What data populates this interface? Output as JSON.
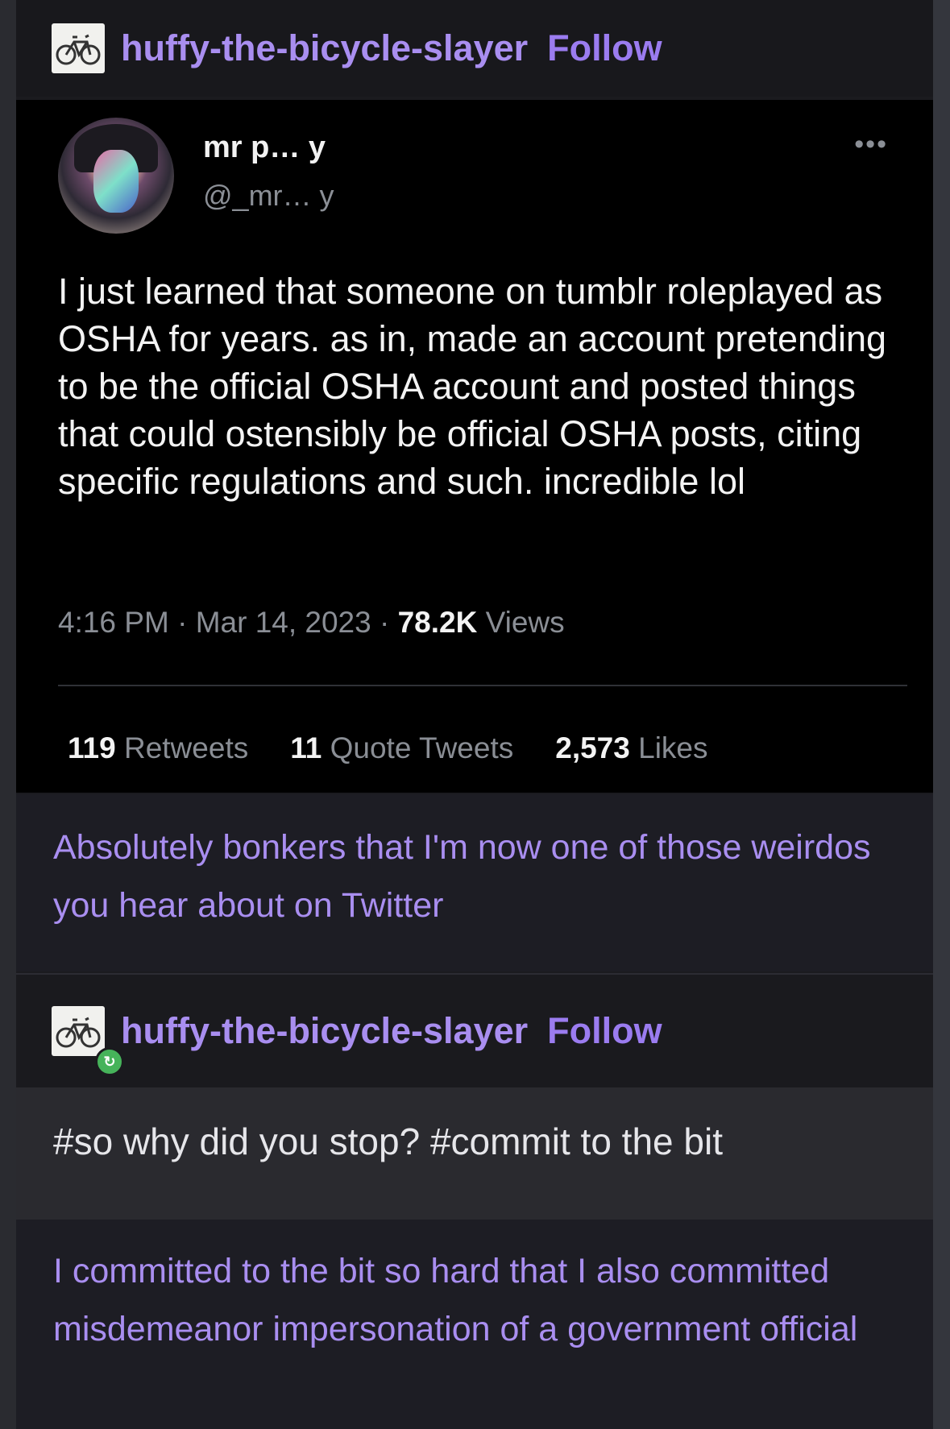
{
  "post": {
    "blog_name": "huffy-the-bicycle-slayer",
    "follow_label": "Follow"
  },
  "tweet": {
    "display_name": "mr p… y",
    "handle": "@_mr… y",
    "more_label": "•••",
    "text": "I just learned that someone on tumblr roleplayed as OSHA for years. as in, made an account pretending to be the official OSHA account and posted things that could ostensibly be official OSHA posts, citing specific regulations and such. incredible lol",
    "time": "4:16 PM",
    "date": "Mar 14, 2023",
    "views_count": "78.2K",
    "views_label": "Views",
    "stats": [
      {
        "num": "119",
        "label": "Retweets"
      },
      {
        "num": "11",
        "label": "Quote Tweets"
      },
      {
        "num": "2,573",
        "label": "Likes"
      }
    ]
  },
  "reply1": {
    "text": "Absolutely bonkers that I'm now one of those weirdos you hear about on Twitter"
  },
  "reblog": {
    "blog_name": "huffy-the-bicycle-slayer",
    "follow_label": "Follow",
    "tags": "#so why did you stop? #commit to the bit"
  },
  "reply2": {
    "text": "I committed to the bit so hard that I also committed misdemeanor impersonation of a government official"
  },
  "colors": {
    "accent": "#a98ef0",
    "background": "#1b1b1f",
    "tweet_bg": "#000000",
    "reblog_badge": "#46b35a"
  }
}
